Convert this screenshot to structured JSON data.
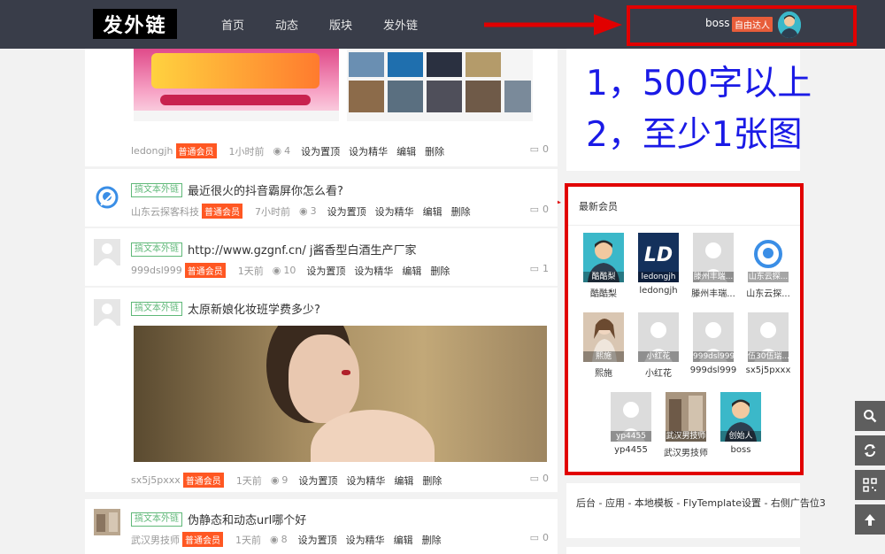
{
  "header": {
    "logo_text": "发外链",
    "nav": [
      "首页",
      "动态",
      "版块",
      "发外链"
    ],
    "username": "boss",
    "user_badge": "自由达人"
  },
  "feed": {
    "posts": [
      {
        "author": "ledongjh",
        "badge": "普通会员",
        "time": "1小时前",
        "views": "4",
        "actions": [
          "设为置顶",
          "设为精华",
          "编辑",
          "删除"
        ],
        "comments": "0"
      },
      {
        "tag": "搞文本外链",
        "title": "最近很火的抖音霸屏你怎么看?",
        "author": "山东云探客科技",
        "badge": "普通会员",
        "time": "7小时前",
        "views": "3",
        "actions": [
          "设为置顶",
          "设为精华",
          "编辑",
          "删除"
        ],
        "comments": "0"
      },
      {
        "tag": "搞文本外链",
        "title": "http://www.gzgnf.cn/ j酱香型白酒生产厂家",
        "author": "999dsl999",
        "badge": "普通会员",
        "time": "1天前",
        "views": "10",
        "actions": [
          "设为置顶",
          "设为精华",
          "编辑",
          "删除"
        ],
        "comments": "1"
      },
      {
        "tag": "搞文本外链",
        "title": "太原新娘化妆班学费多少?",
        "author": "sx5j5pxxx",
        "badge": "普通会员",
        "time": "1天前",
        "views": "9",
        "actions": [
          "设为置顶",
          "设为精华",
          "编辑",
          "删除"
        ],
        "comments": "0"
      },
      {
        "tag": "搞文本外链",
        "title": "伪静态和动态url哪个好",
        "author": "武汉男技师",
        "badge": "普通会员",
        "time": "1天前",
        "views": "8",
        "actions": [
          "设为置顶",
          "设为精华",
          "编辑",
          "删除"
        ],
        "comments": "0"
      }
    ]
  },
  "sidebar": {
    "notice_lines": [
      "1，500字以上",
      "2，至少1张图"
    ],
    "members_title": "最新会员",
    "members": [
      {
        "overlay": "酷酷梨",
        "name": "酷酷梨"
      },
      {
        "overlay": "ledongjh",
        "name": "ledongjh"
      },
      {
        "overlay": "滕州丰瑞...",
        "name": "滕州丰瑞..."
      },
      {
        "overlay": "山东云探...",
        "name": "山东云探..."
      },
      {
        "overlay": "熙施",
        "name": "熙施"
      },
      {
        "overlay": "小红花",
        "name": "小红花"
      },
      {
        "overlay": "999dsl999",
        "name": "999dsl999"
      },
      {
        "overlay": "伍30伍瑞...",
        "name": "sx5j5pxxx"
      },
      {
        "overlay": "yp4455",
        "name": "yp4455"
      },
      {
        "overlay": "武汉男技师",
        "name": "武汉男技师"
      },
      {
        "overlay": "创始人",
        "name": "boss"
      }
    ],
    "ad_text": "后台 - 应用 - 本地模板 - FlyTemplate设置 - 右侧广告位3"
  },
  "colors": {
    "header_bg": "#393d49",
    "badge_orange": "#ff5722",
    "tag_green": "#5fb878",
    "annotation_red": "#e10000",
    "notice_blue": "#1a1ae6"
  }
}
